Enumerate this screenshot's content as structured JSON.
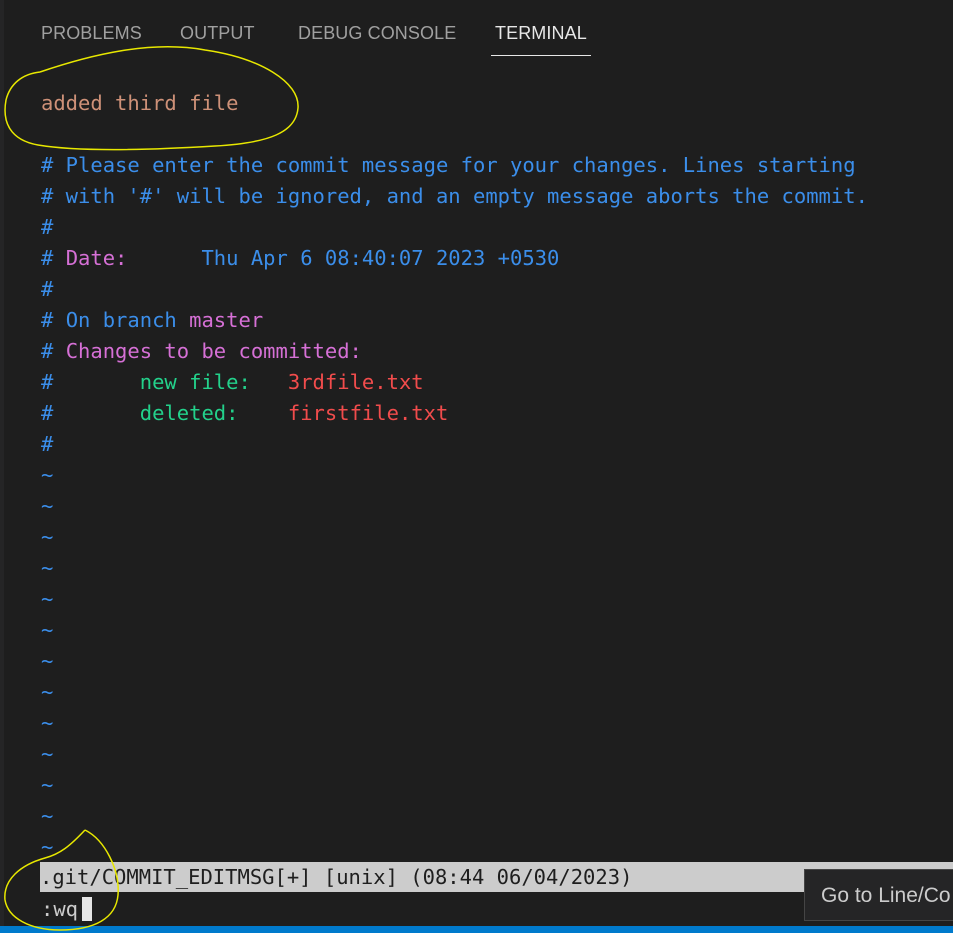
{
  "panel": {
    "tabs": [
      {
        "label": "PROBLEMS",
        "active": false
      },
      {
        "label": "OUTPUT",
        "active": false
      },
      {
        "label": "DEBUG CONSOLE",
        "active": false
      },
      {
        "label": "TERMINAL",
        "active": true
      }
    ]
  },
  "terminal": {
    "commit_message": "added third file",
    "comment_line1": "# Please enter the commit message for your changes. Lines starting",
    "comment_line2": "# with '#' will be ignored, and an empty message aborts the commit.",
    "hash": "#",
    "hash_space": "# ",
    "date_label": "Date:",
    "date_value": "      Thu Apr 6 08:40:07 2023 +0530",
    "branch_prefix": "On branch ",
    "branch_name": "master",
    "changes_label": "Changes to be committed:",
    "change_indent": "#       ",
    "new_file_label": "new file:   ",
    "new_file_name": "3rdfile.txt",
    "deleted_label": "deleted:    ",
    "deleted_file_name": "firstfile.txt",
    "tilde": "~"
  },
  "vim": {
    "status_line": ".git/COMMIT_EDITMSG[+] [unix] (08:44 06/04/2023)",
    "command": ":wq"
  },
  "tooltip": {
    "text": "Go to Line/Co"
  },
  "colors": {
    "background": "#1e1e1e",
    "comment_blue": "#3b8eea",
    "magenta": "#d670d6",
    "green": "#23d18b",
    "red": "#f14c4c",
    "orange": "#ce9178",
    "annotation_yellow": "#e8e800"
  }
}
